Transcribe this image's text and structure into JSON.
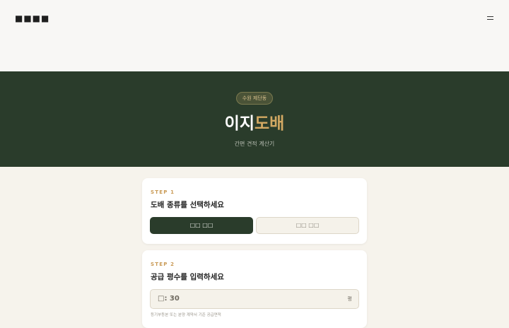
{
  "header": {
    "logo_text": "■■■■",
    "menu_icon": "hamburger-menu-icon"
  },
  "hero": {
    "badge": "수원 제단동",
    "title_main": "이지",
    "title_accent": "도배",
    "subtitle": "간편 견적 계산기"
  },
  "step1": {
    "label": "STEP 1",
    "title": "도배 종류를 선택하세요",
    "options": [
      "□□ □□",
      "□□ □□"
    ],
    "selected_index": 0
  },
  "step2": {
    "label": "STEP 2",
    "title": "공급 평수를 입력하세요",
    "input_value": "□: 30",
    "unit": "평",
    "hint": "등기부등본 또는 분양 계약서 기준 공급면적"
  },
  "colors": {
    "primary": "#2a3c2b",
    "accent": "#d3a963",
    "background": "#f6f3ec"
  }
}
